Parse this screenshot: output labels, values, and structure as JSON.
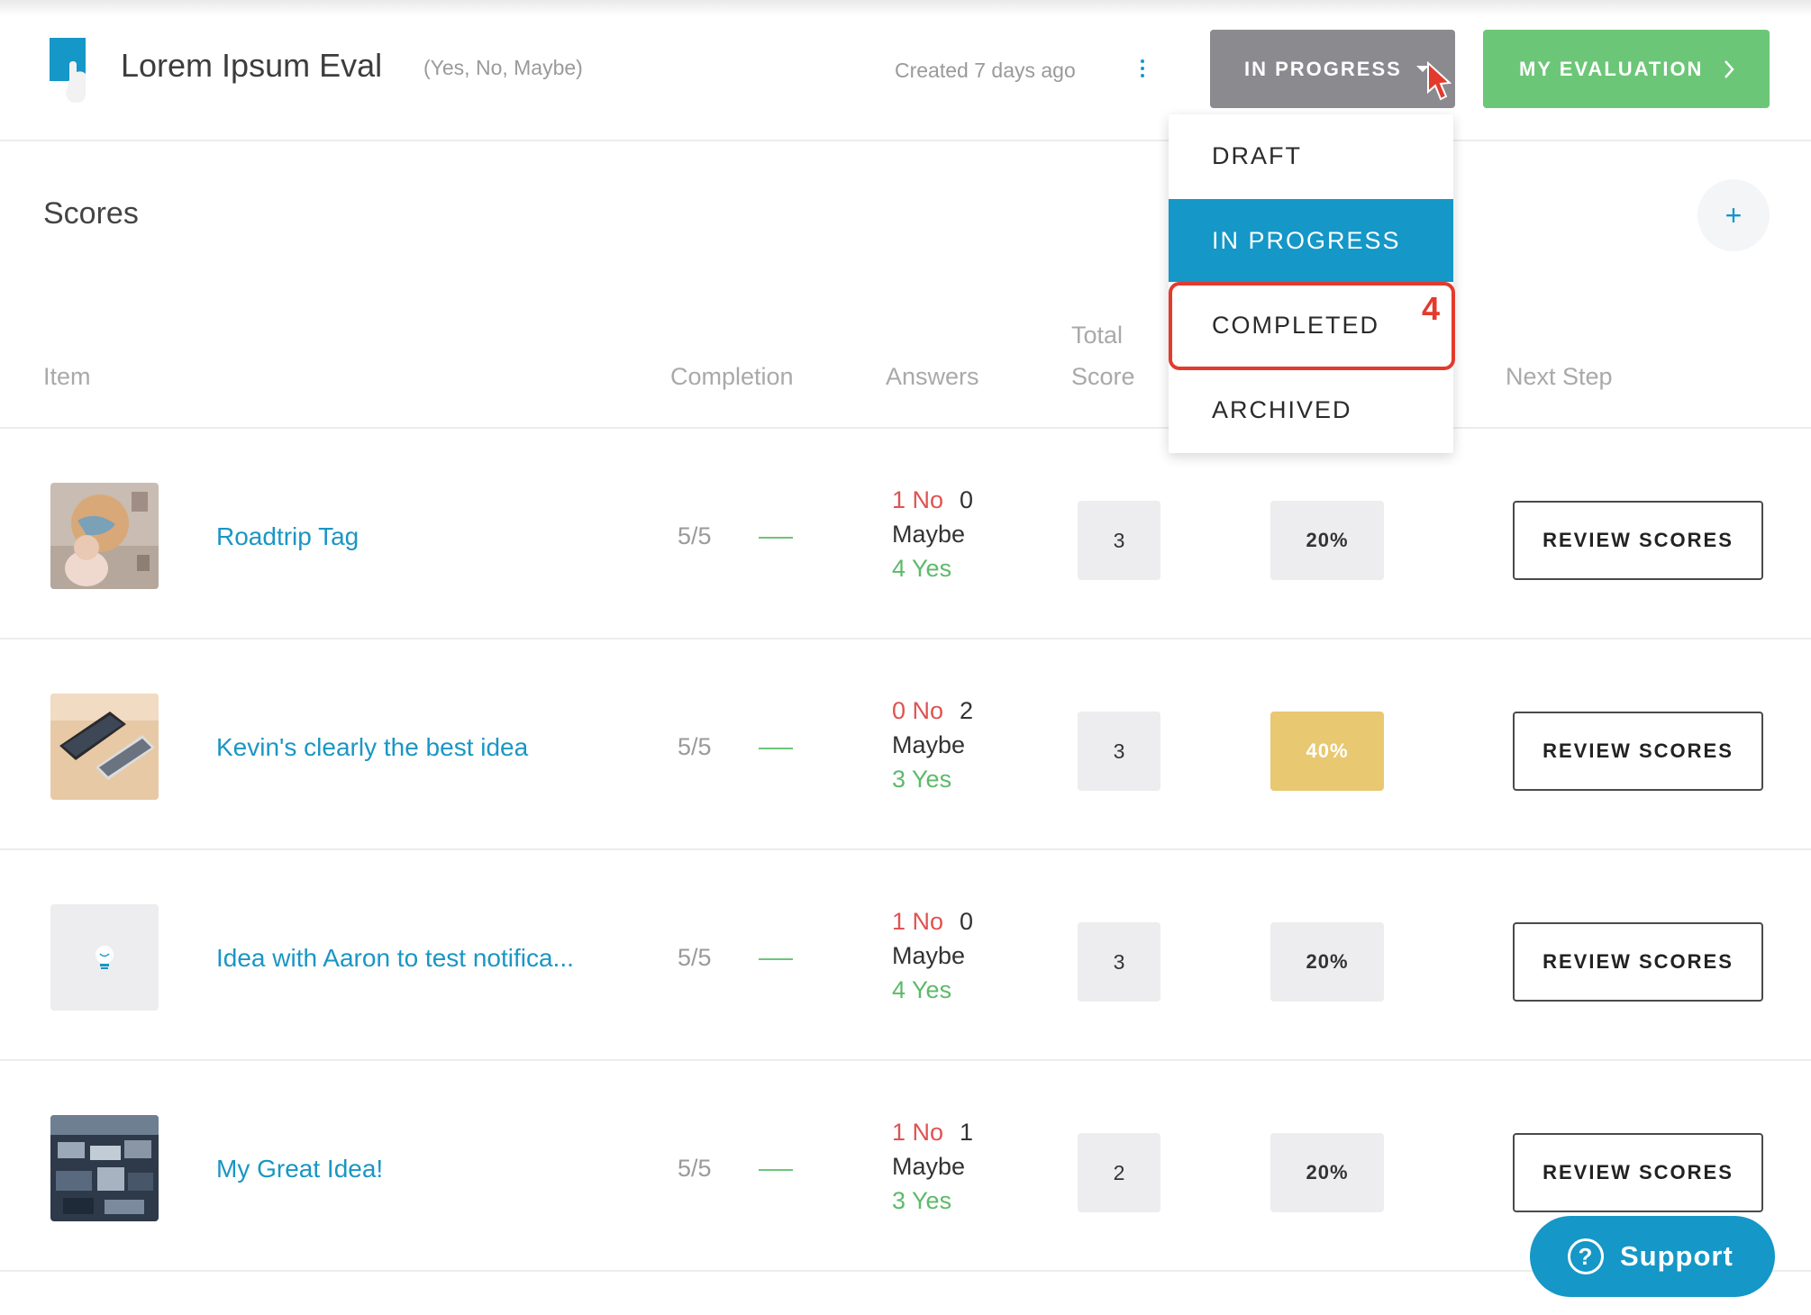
{
  "header": {
    "title": "Lorem Ipsum Eval",
    "subtitle": "(Yes, No, Maybe)",
    "created": "Created 7 days ago",
    "status_label": "IN PROGRESS",
    "my_evaluation_label": "MY EVALUATION"
  },
  "scores": {
    "title": "Scores",
    "add_label": "+"
  },
  "columns": {
    "item": "Item",
    "completion": "Completion",
    "answers": "Answers",
    "total_line1": "Total",
    "total_line2": "Score",
    "next_step": "Next Step"
  },
  "dropdown": {
    "items": [
      "DRAFT",
      "IN PROGRESS",
      "COMPLETED",
      "ARCHIVED"
    ],
    "selected": "IN PROGRESS",
    "annotation_number": "4"
  },
  "rows": [
    {
      "name": "Roadtrip Tag",
      "completion": "5/5",
      "no": "1 No",
      "maybe_count": "0",
      "maybe": "Maybe",
      "yes": "4 Yes",
      "total": "3",
      "percent": "20%",
      "action": "REVIEW SCORES"
    },
    {
      "name": "Kevin's clearly the best idea",
      "completion": "5/5",
      "no": "0 No",
      "maybe_count": "2",
      "maybe": "Maybe",
      "yes": "3 Yes",
      "total": "3",
      "percent": "40%",
      "action": "REVIEW SCORES"
    },
    {
      "name": "Idea with Aaron to test notifica...",
      "completion": "5/5",
      "no": "1 No",
      "maybe_count": "0",
      "maybe": "Maybe",
      "yes": "4 Yes",
      "total": "3",
      "percent": "20%",
      "action": "REVIEW SCORES"
    },
    {
      "name": "My Great Idea!",
      "completion": "5/5",
      "no": "1 No",
      "maybe_count": "1",
      "maybe": "Maybe",
      "yes": "3 Yes",
      "total": "2",
      "percent": "20%",
      "action": "REVIEW SCORES"
    }
  ],
  "support": {
    "label": "Support"
  },
  "colors": {
    "accent": "#1597c7",
    "status_button": "#8a8a8f",
    "my_evaluation_button": "#6cc677",
    "highlight_percent": "#e8c871",
    "no": "#e05252",
    "yes": "#5cba6a",
    "annotation": "#e23b2e"
  },
  "icons": {
    "logo": "logo-icon",
    "kebab": "kebab-menu-icon",
    "caret": "caret-down-icon",
    "chevron": "chevron-right-icon",
    "pointer": "mouse-pointer-icon",
    "lightbulb": "lightbulb-icon",
    "support": "question-circle-icon"
  }
}
